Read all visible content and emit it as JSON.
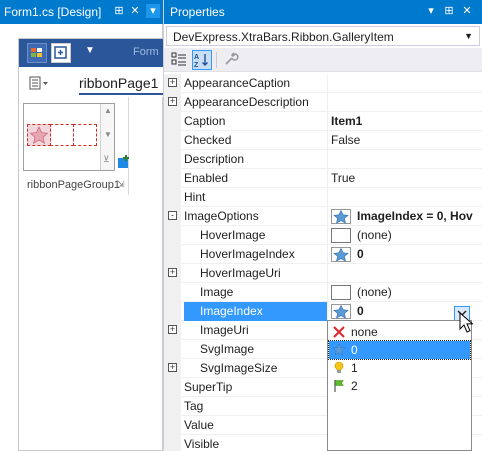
{
  "designer": {
    "tab_title": "Form1.cs [Design]",
    "pin_glyph": "⊞",
    "close_glyph": "✕",
    "qat_form_text": "Form",
    "ribbon_page_label": "ribbonPage1",
    "group_label": "ribbonPageGroup1"
  },
  "properties": {
    "window_title": "Properties",
    "menu_glyph": "▾",
    "pin_glyph": "⊞",
    "close_glyph": "✕",
    "object_selector": "DevExpress.XtraBars.Ribbon.GalleryItem",
    "selector_arrow": "▼",
    "rows": [
      {
        "name": "AppearanceCaption",
        "value": "",
        "expander": "+"
      },
      {
        "name": "AppearanceDescription",
        "value": "",
        "expander": "+"
      },
      {
        "name": "Caption",
        "value": "Item1",
        "bold": true
      },
      {
        "name": "Checked",
        "value": "False"
      },
      {
        "name": "Description",
        "value": ""
      },
      {
        "name": "Enabled",
        "value": "True"
      },
      {
        "name": "Hint",
        "value": ""
      },
      {
        "name": "ImageOptions",
        "value": "ImageIndex = 0, Hov",
        "expander": "-",
        "bold": true,
        "icon": "star"
      },
      {
        "name": "HoverImage",
        "value": "(none)",
        "sub": true,
        "icon": "swatch"
      },
      {
        "name": "HoverImageIndex",
        "value": "0",
        "sub": true,
        "bold": true,
        "icon": "star"
      },
      {
        "name": "HoverImageUri",
        "value": "",
        "sub": true,
        "expander": "+"
      },
      {
        "name": "Image",
        "value": "(none)",
        "sub": true,
        "icon": "swatch"
      },
      {
        "name": "ImageIndex",
        "value": "0",
        "sub": true,
        "bold": true,
        "icon": "star",
        "selected": true
      },
      {
        "name": "ImageUri",
        "value": "",
        "sub": true,
        "expander": "+"
      },
      {
        "name": "SvgImage",
        "value": "",
        "sub": true
      },
      {
        "name": "SvgImageSize",
        "value": "",
        "sub": true,
        "expander": "+"
      },
      {
        "name": "SuperTip",
        "value": ""
      },
      {
        "name": "Tag",
        "value": ""
      },
      {
        "name": "Value",
        "value": ""
      },
      {
        "name": "Visible",
        "value": ""
      }
    ]
  },
  "dropdown": {
    "items": [
      {
        "label": "none",
        "icon": "red-x-icon"
      },
      {
        "label": "0",
        "icon": "star-icon",
        "selected": true
      },
      {
        "label": "1",
        "icon": "lightbulb-icon"
      },
      {
        "label": "2",
        "icon": "green-flag-icon"
      }
    ]
  },
  "colors": {
    "title_bar": "#007acc",
    "selection": "#3399ff",
    "ribbon_qat": "#2b579a"
  }
}
